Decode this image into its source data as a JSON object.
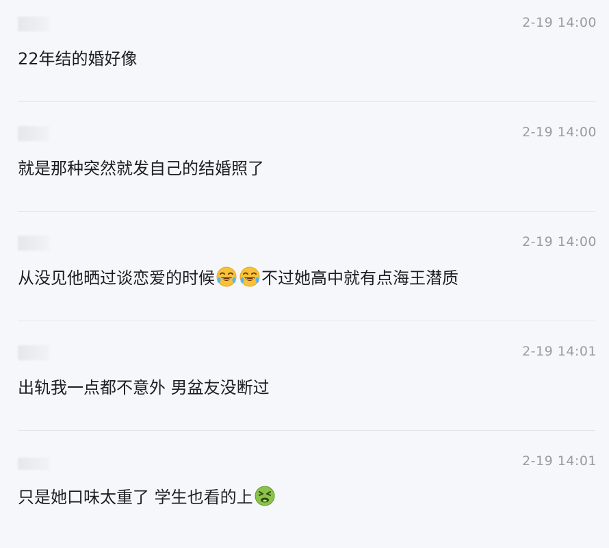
{
  "comments": [
    {
      "timestamp": "2-19 14:00",
      "text": "22年结的婚好像"
    },
    {
      "timestamp": "2-19 14:00",
      "text": "就是那种突然就发自己的结婚照了"
    },
    {
      "timestamp": "2-19 14:00",
      "text_before": "从没见他晒过谈恋爱的时候",
      "text_after": "不过她高中就有点海王潜质",
      "emojis": [
        "laughing-crying-emoji",
        "laughing-crying-emoji"
      ]
    },
    {
      "timestamp": "2-19 14:01",
      "text": "出轨我一点都不意外 男盆友没断过"
    },
    {
      "timestamp": "2-19 14:01",
      "text": "只是她口味太重了 学生也看的上",
      "emojis": [
        "nauseated-emoji"
      ]
    }
  ]
}
